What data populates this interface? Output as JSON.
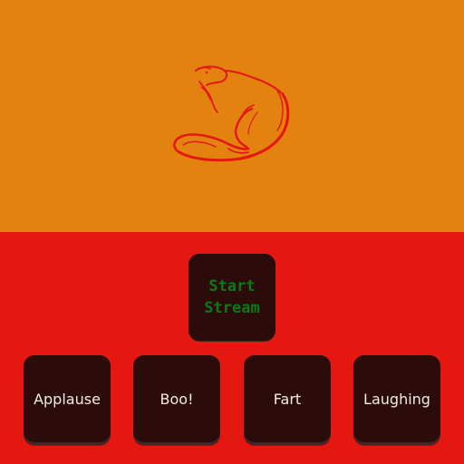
{
  "colors": {
    "top_background": "#e3820e",
    "bottom_background": "#e41711",
    "key_background": "#2b0c0a",
    "start_text": "#0b7a14",
    "sound_text": "#f2ece8",
    "logo_stroke": "#e41711"
  },
  "logo": {
    "icon": "beaver-outline-icon"
  },
  "stream_button": {
    "label": "Start\nStream"
  },
  "sound_buttons": [
    {
      "label": "Applause"
    },
    {
      "label": "Boo!"
    },
    {
      "label": "Fart"
    },
    {
      "label": "Laughing"
    }
  ]
}
